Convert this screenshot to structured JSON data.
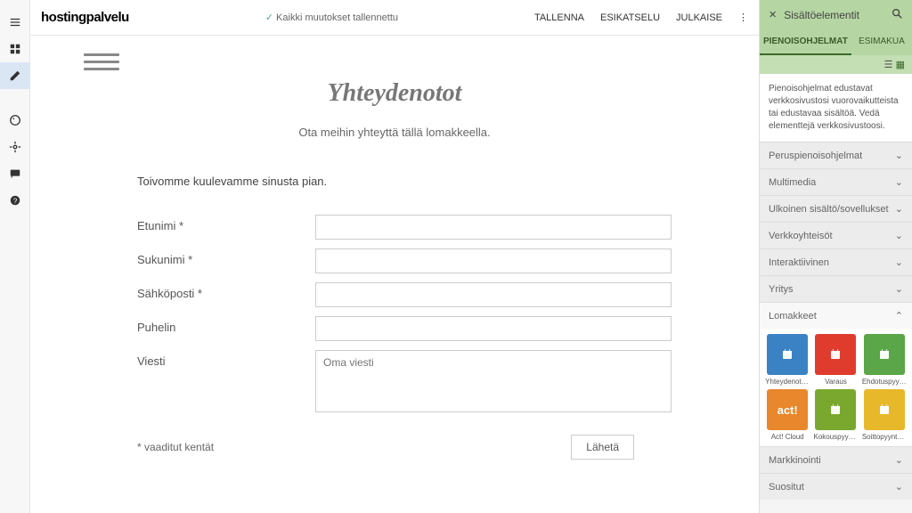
{
  "brand": "hostingpalvelu",
  "saved_status": "Kaikki muutokset tallennettu",
  "top": {
    "save": "TALLENNA",
    "preview": "ESIKATSELU",
    "publish": "JULKAISE"
  },
  "page": {
    "title": "Yhteydenotot",
    "subtitle": "Ota meihin yhteyttä tällä lomakkeella.",
    "intro": "Toivomme kuulevamme sinusta pian.",
    "firstname": "Etunimi *",
    "lastname": "Sukunimi *",
    "email": "Sähköposti *",
    "phone": "Puhelin",
    "message": "Viesti",
    "message_ph": "Oma viesti",
    "required": "* vaaditut kentät",
    "send": "Lähetä"
  },
  "panel": {
    "title": "Sisältöelementit",
    "tab1": "PIENOISOHJELMAT",
    "tab2": "ESIMAKUA",
    "desc": "Pienoisohjelmat edustavat verkkosivustosi vuorovaikutteista tai edustavaa sisältöä. Vedä elementtejä verkkosivustoosi.",
    "cats": {
      "c1": "Peruspienoisohjelmat",
      "c2": "Multimedia",
      "c3": "Ulkoinen sisältö/sovellukset",
      "c4": "Verkkoyhteisöt",
      "c5": "Interaktiivinen",
      "c6": "Yritys",
      "c7": "Lomakkeet",
      "c8": "Markkinointi",
      "c9": "Suositut"
    },
    "widgets": [
      {
        "label": "Yhteydenotto...",
        "color": "#3b82c4"
      },
      {
        "label": "Varaus",
        "color": "#e03c2e"
      },
      {
        "label": "Ehdotuspyyntö",
        "color": "#5aa648"
      },
      {
        "label": "Act! Cloud",
        "color": "#e8872b"
      },
      {
        "label": "Kokouspyyntö",
        "color": "#7aa82e"
      },
      {
        "label": "Soittopyyntö...",
        "color": "#e8b82b"
      }
    ]
  }
}
